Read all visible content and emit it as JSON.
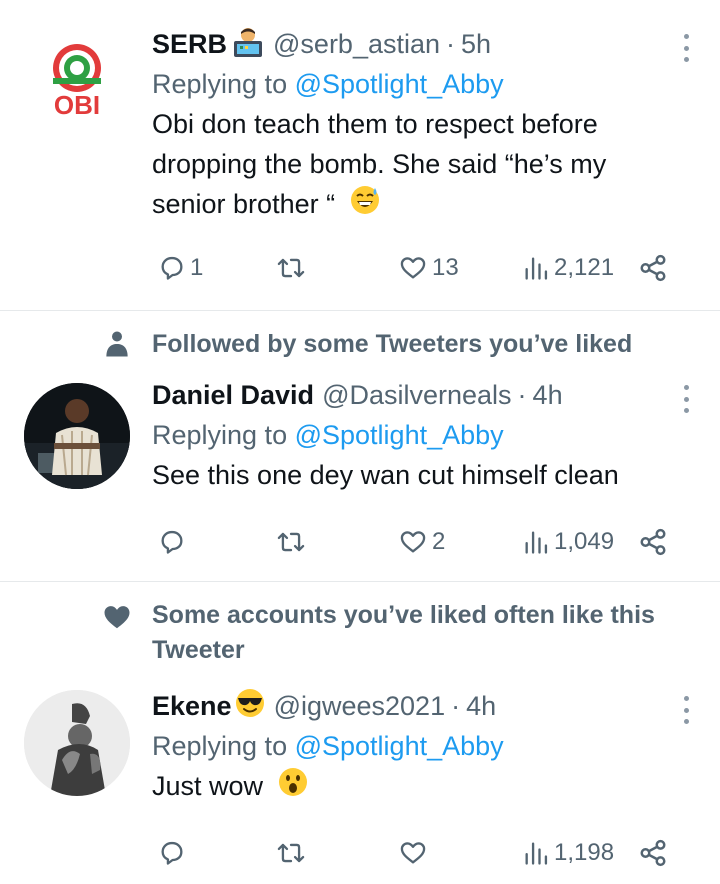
{
  "tweets": [
    {
      "name": "SERB",
      "handle": "@serb_astian",
      "time": "5h",
      "reply_prefix": "Replying to",
      "reply_to": "@Spotlight_Abby",
      "text_lines": [
        "Obi don teach them to respect before",
        "dropping the bomb. She said “he’s my",
        "senior brother “"
      ],
      "counts": {
        "replies": "1",
        "retweets": "",
        "likes": "13",
        "views": "2,121"
      },
      "avatar_text": "OBI",
      "name_emoji": "technologist-emoji",
      "text_emoji": "sweat-smile-emoji"
    },
    {
      "social_context": "Followed by some Tweeters you’ve liked",
      "social_icon": "person-icon",
      "name": "Daniel David",
      "handle": "@Dasilverneals",
      "time": "4h",
      "reply_prefix": "Replying to",
      "reply_to": "@Spotlight_Abby",
      "text_lines": [
        "See this one dey wan cut himself clean"
      ],
      "counts": {
        "replies": "",
        "retweets": "",
        "likes": "2",
        "views": "1,049"
      }
    },
    {
      "social_context_lines": [
        "Some accounts you’ve liked often like this",
        "Tweeter"
      ],
      "social_icon": "heart-icon",
      "name": "Ekene",
      "handle": "@igwees2021",
      "time": "4h",
      "reply_prefix": "Replying to",
      "reply_to": "@Spotlight_Abby",
      "text_lines": [
        "Just wow"
      ],
      "counts": {
        "replies": "",
        "retweets": "",
        "likes": "",
        "views": "1,198"
      },
      "name_emoji": "sunglasses-emoji",
      "text_emoji": "astonished-emoji"
    }
  ],
  "separator": "·",
  "colors": {
    "link": "#1d9bf0",
    "secondary": "#536471",
    "text": "#0f1419",
    "divider": "#e6e9eb"
  }
}
